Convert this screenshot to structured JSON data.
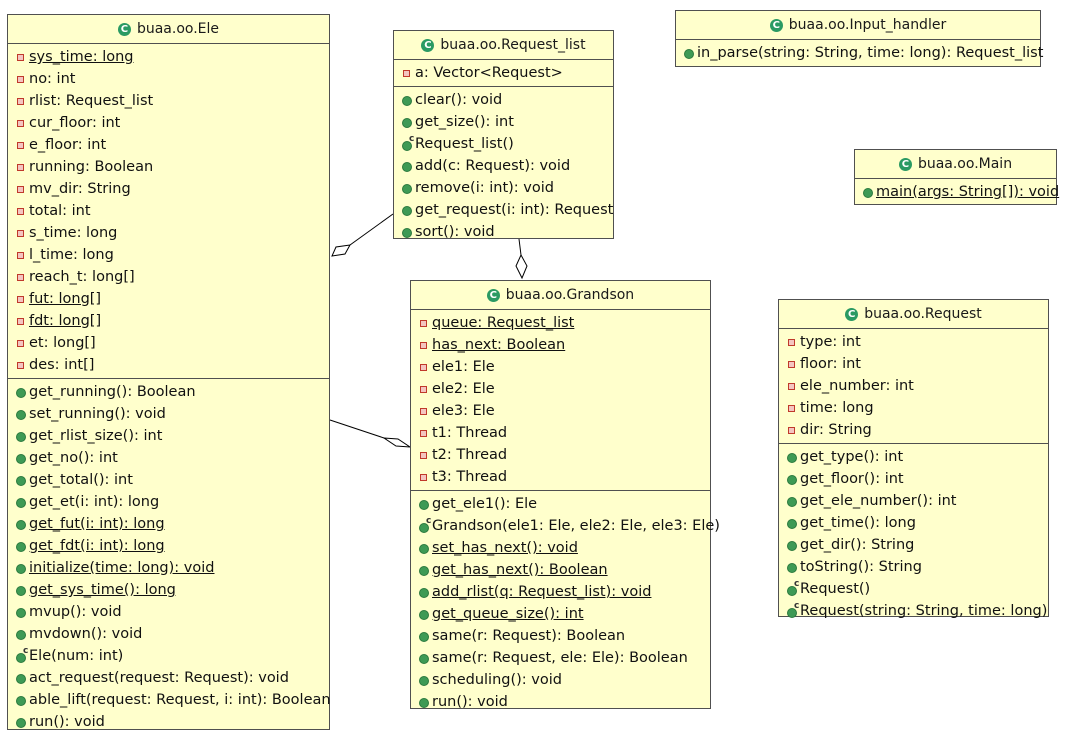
{
  "classes": [
    {
      "id": "ele",
      "name": "buaa.oo.Ele",
      "attributes": [
        {
          "text": "sys_time: long",
          "visibility": "private",
          "static": true
        },
        {
          "text": "no: int",
          "visibility": "private",
          "static": false
        },
        {
          "text": "rlist: Request_list",
          "visibility": "private",
          "static": false
        },
        {
          "text": "cur_floor: int",
          "visibility": "private",
          "static": false
        },
        {
          "text": "e_floor: int",
          "visibility": "private",
          "static": false
        },
        {
          "text": "running: Boolean",
          "visibility": "private",
          "static": false
        },
        {
          "text": "mv_dir: String",
          "visibility": "private",
          "static": false
        },
        {
          "text": "total: int",
          "visibility": "private",
          "static": false
        },
        {
          "text": "s_time: long",
          "visibility": "private",
          "static": false
        },
        {
          "text": "l_time: long",
          "visibility": "private",
          "static": false
        },
        {
          "text": "reach_t: long[]",
          "visibility": "private",
          "static": false
        },
        {
          "text": "fut: long[]",
          "visibility": "private",
          "static": true
        },
        {
          "text": "fdt: long[]",
          "visibility": "private",
          "static": true
        },
        {
          "text": "et: long[]",
          "visibility": "private",
          "static": false
        },
        {
          "text": "des: int[]",
          "visibility": "private",
          "static": false
        }
      ],
      "operations": [
        {
          "text": "get_running(): Boolean",
          "visibility": "public",
          "static": false
        },
        {
          "text": "set_running(): void",
          "visibility": "public",
          "static": false
        },
        {
          "text": "get_rlist_size(): int",
          "visibility": "public",
          "static": false
        },
        {
          "text": "get_no(): int",
          "visibility": "public",
          "static": false
        },
        {
          "text": "get_total(): int",
          "visibility": "public",
          "static": false
        },
        {
          "text": "get_et(i: int): long",
          "visibility": "public",
          "static": false
        },
        {
          "text": "get_fut(i: int): long",
          "visibility": "public",
          "static": true
        },
        {
          "text": "get_fdt(i: int): long",
          "visibility": "public",
          "static": true
        },
        {
          "text": "initialize(time: long): void",
          "visibility": "public",
          "static": true
        },
        {
          "text": "get_sys_time(): long",
          "visibility": "public",
          "static": true
        },
        {
          "text": "mvup(): void",
          "visibility": "public",
          "static": false
        },
        {
          "text": "mvdown(): void",
          "visibility": "public",
          "static": false
        },
        {
          "text": "Ele(num: int)",
          "visibility": "ctor",
          "static": false
        },
        {
          "text": "act_request(request: Request): void",
          "visibility": "public",
          "static": false
        },
        {
          "text": "able_lift(request: Request, i: int): Boolean",
          "visibility": "public",
          "static": false
        },
        {
          "text": "run(): void",
          "visibility": "public",
          "static": false
        }
      ]
    },
    {
      "id": "request-list",
      "name": "buaa.oo.Request_list",
      "attributes": [
        {
          "text": "a: Vector<Request>",
          "visibility": "private",
          "static": false
        }
      ],
      "operations": [
        {
          "text": "clear(): void",
          "visibility": "public",
          "static": false
        },
        {
          "text": "get_size(): int",
          "visibility": "public",
          "static": false
        },
        {
          "text": "Request_list()",
          "visibility": "ctor",
          "static": false
        },
        {
          "text": "add(c: Request): void",
          "visibility": "public",
          "static": false
        },
        {
          "text": "remove(i: int): void",
          "visibility": "public",
          "static": false
        },
        {
          "text": "get_request(i: int): Request",
          "visibility": "public",
          "static": false
        },
        {
          "text": "sort(): void",
          "visibility": "public",
          "static": false
        }
      ]
    },
    {
      "id": "input-handler",
      "name": "buaa.oo.Input_handler",
      "attributes": [],
      "operations": [
        {
          "text": "in_parse(string: String, time: long): Request_list",
          "visibility": "public",
          "static": false
        }
      ]
    },
    {
      "id": "main",
      "name": "buaa.oo.Main",
      "attributes": [],
      "operations": [
        {
          "text": "main(args: String[]): void",
          "visibility": "public",
          "static": true
        }
      ]
    },
    {
      "id": "grandson",
      "name": "buaa.oo.Grandson",
      "attributes": [
        {
          "text": "queue: Request_list",
          "visibility": "private",
          "static": true
        },
        {
          "text": "has_next: Boolean",
          "visibility": "private",
          "static": true
        },
        {
          "text": "ele1: Ele",
          "visibility": "private",
          "static": false
        },
        {
          "text": "ele2: Ele",
          "visibility": "private",
          "static": false
        },
        {
          "text": "ele3: Ele",
          "visibility": "private",
          "static": false
        },
        {
          "text": "t1: Thread",
          "visibility": "private",
          "static": false
        },
        {
          "text": "t2: Thread",
          "visibility": "private",
          "static": false
        },
        {
          "text": "t3: Thread",
          "visibility": "private",
          "static": false
        }
      ],
      "operations": [
        {
          "text": "get_ele1(): Ele",
          "visibility": "public",
          "static": false
        },
        {
          "text": "Grandson(ele1: Ele, ele2: Ele, ele3: Ele)",
          "visibility": "ctor",
          "static": false
        },
        {
          "text": "set_has_next(): void",
          "visibility": "public",
          "static": true
        },
        {
          "text": "get_has_next(): Boolean",
          "visibility": "public",
          "static": true
        },
        {
          "text": "add_rlist(q: Request_list): void",
          "visibility": "public",
          "static": true
        },
        {
          "text": "get_queue_size(): int",
          "visibility": "public",
          "static": true
        },
        {
          "text": "same(r: Request): Boolean",
          "visibility": "public",
          "static": false
        },
        {
          "text": "same(r: Request, ele: Ele): Boolean",
          "visibility": "public",
          "static": false
        },
        {
          "text": "scheduling(): void",
          "visibility": "public",
          "static": false
        },
        {
          "text": "run(): void",
          "visibility": "public",
          "static": false
        }
      ]
    },
    {
      "id": "request",
      "name": "buaa.oo.Request",
      "attributes": [
        {
          "text": "type: int",
          "visibility": "private",
          "static": false
        },
        {
          "text": "floor: int",
          "visibility": "private",
          "static": false
        },
        {
          "text": "ele_number: int",
          "visibility": "private",
          "static": false
        },
        {
          "text": "time: long",
          "visibility": "private",
          "static": false
        },
        {
          "text": "dir: String",
          "visibility": "private",
          "static": false
        }
      ],
      "operations": [
        {
          "text": "get_type(): int",
          "visibility": "public",
          "static": false
        },
        {
          "text": "get_floor(): int",
          "visibility": "public",
          "static": false
        },
        {
          "text": "get_ele_number(): int",
          "visibility": "public",
          "static": false
        },
        {
          "text": "get_time(): long",
          "visibility": "public",
          "static": false
        },
        {
          "text": "get_dir(): String",
          "visibility": "public",
          "static": false
        },
        {
          "text": "toString(): String",
          "visibility": "public",
          "static": false
        },
        {
          "text": "Request()",
          "visibility": "ctor",
          "static": false
        },
        {
          "text": "Request(string: String, time: long)",
          "visibility": "ctor",
          "static": false
        }
      ]
    }
  ],
  "relations": [
    {
      "from": "request-list",
      "to": "ele",
      "type": "aggregation"
    },
    {
      "from": "request-list",
      "to": "grandson",
      "type": "aggregation"
    },
    {
      "from": "ele",
      "to": "grandson",
      "type": "aggregation"
    }
  ],
  "colors": {
    "class_fill": "#ffffcc",
    "class_border": "#505050",
    "public_icon": "#3e9a55",
    "private_icon": "#c0392b",
    "class_icon": "#2a9a63"
  }
}
